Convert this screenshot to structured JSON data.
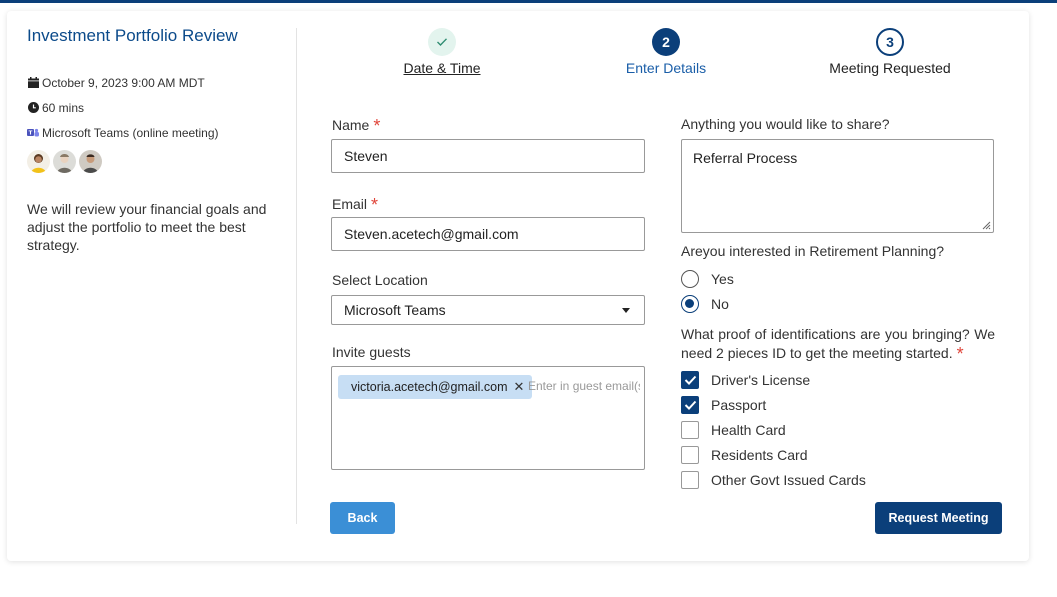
{
  "event": {
    "title": "Investment Portfolio Review",
    "datetime": "October 9, 2023 9:00 AM MDT",
    "duration": "60 mins",
    "location": "Microsoft Teams  (online meeting)",
    "description": "We will review your financial goals and adjust the portfolio to meet the best strategy.",
    "icons": [
      "calendar-icon",
      "clock-icon",
      "teams-icon"
    ]
  },
  "stepper": {
    "steps": [
      {
        "number": "",
        "label": "Date & Time",
        "state": "done"
      },
      {
        "number": "2",
        "label": "Enter Details",
        "state": "active"
      },
      {
        "number": "3",
        "label": "Meeting Requested",
        "state": "next"
      }
    ]
  },
  "form": {
    "name": {
      "label": "Name",
      "required": "*",
      "value": "Steven"
    },
    "email": {
      "label": "Email",
      "required": "*",
      "value": "Steven.acetech@gmail.com"
    },
    "location": {
      "label": "Select Location",
      "value": "Microsoft Teams"
    },
    "guests": {
      "label": "Invite guests",
      "chips": [
        "victoria.acetech@gmail.com"
      ],
      "remove_glyph": "✕",
      "placeholder": "Enter in guest email(s)"
    },
    "share": {
      "label": "Anything you would like to share?",
      "value": "Referral Process"
    },
    "retirement": {
      "label": "Areyou interested in Retirement Planning?",
      "options": [
        {
          "label": "Yes",
          "selected": false
        },
        {
          "label": "No",
          "selected": true
        }
      ]
    },
    "ids": {
      "label": "What proof of identifications are you bringing? We need 2 pieces ID to get the meeting started.",
      "required": "*",
      "options": [
        {
          "label": "Driver's License",
          "checked": true
        },
        {
          "label": "Passport",
          "checked": true
        },
        {
          "label": "Health Card",
          "checked": false
        },
        {
          "label": "Residents Card",
          "checked": false
        },
        {
          "label": "Other Govt Issued Cards",
          "checked": false
        }
      ]
    }
  },
  "buttons": {
    "back": "Back",
    "request": "Request Meeting"
  },
  "colors": {
    "primary": "#0b3f7a",
    "secondary": "#3b8fd6",
    "required": "#e0453a",
    "chip": "#c7def4"
  }
}
